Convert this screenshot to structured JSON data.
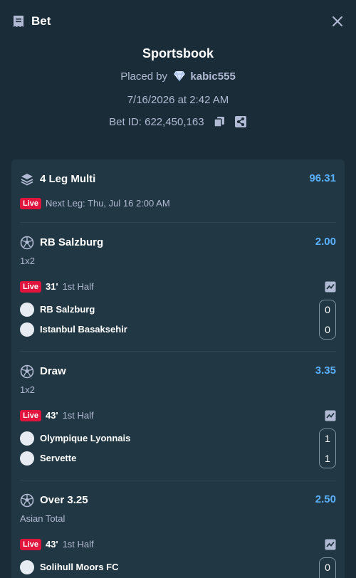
{
  "header": {
    "title": "Bet",
    "icons": {
      "bet": "receipt-icon",
      "close": "close-icon"
    }
  },
  "summary": {
    "platform": "Sportsbook",
    "placed_by_label": "Placed by",
    "username": "kabic555",
    "datetime": "7/16/2026 at 2:42 AM",
    "bet_id_label": "Bet ID: 622,450,163"
  },
  "multi": {
    "title": "4 Leg Multi",
    "odds": "96.31",
    "live_label": "Live",
    "next_leg": "Next Leg: Thu, Jul 16 2:00 AM"
  },
  "legs": [
    {
      "selection": "RB Salzburg",
      "odds": "2.00",
      "market": "1x2",
      "live_label": "Live",
      "minute": "31'",
      "period": "1st Half",
      "teams": [
        {
          "name": "RB Salzburg",
          "score": "0"
        },
        {
          "name": "Istanbul Basaksehir",
          "score": "0"
        }
      ]
    },
    {
      "selection": "Draw",
      "odds": "3.35",
      "market": "1x2",
      "live_label": "Live",
      "minute": "43'",
      "period": "1st Half",
      "teams": [
        {
          "name": "Olympique Lyonnais",
          "score": "1"
        },
        {
          "name": "Servette",
          "score": "1"
        }
      ]
    },
    {
      "selection": "Over 3.25",
      "odds": "2.50",
      "market": "Asian Total",
      "live_label": "Live",
      "minute": "43'",
      "period": "1st Half",
      "teams": [
        {
          "name": "Solihull Moors FC",
          "score": "0"
        }
      ]
    }
  ],
  "colors": {
    "background": "#1a2c38",
    "card": "#213743",
    "odds": "#5ab0ff",
    "live": "#e0143c",
    "muted": "#b1bad3"
  }
}
